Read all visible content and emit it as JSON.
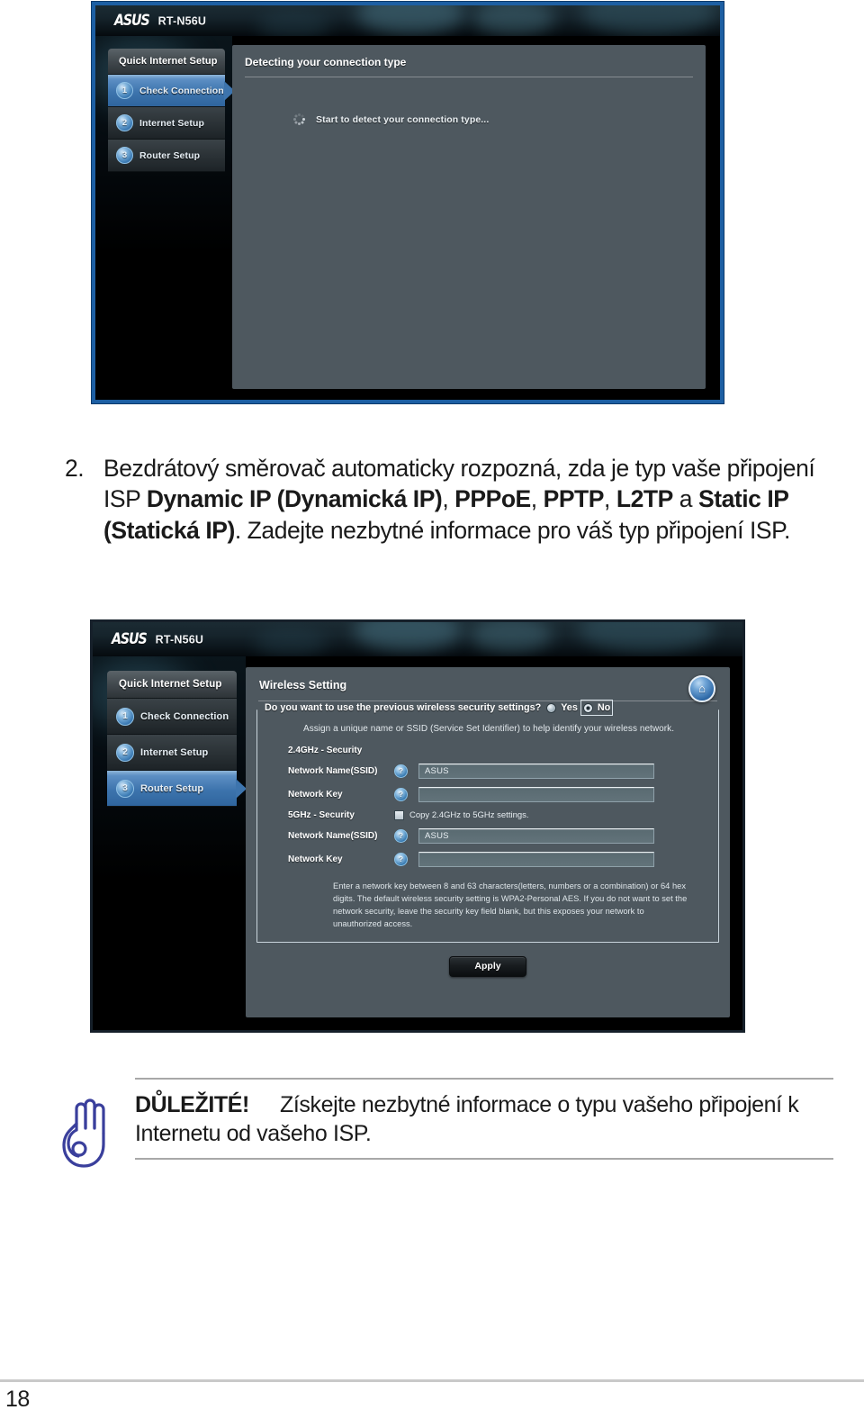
{
  "document": {
    "page_number": "18",
    "step": {
      "number": "2.",
      "text_part1": "Bezdrátový směrovač automaticky rozpozná, zda je typ vaše připojení ISP ",
      "bold1": "Dynamic IP (Dynamická IP)",
      "text_part2": ", ",
      "bold2": "PPPoE",
      "text_part3": ", ",
      "bold3": "PPTP",
      "text_part4": ", ",
      "bold4": "L2TP",
      "text_part5": " a ",
      "bold5": "Static IP (Statická IP)",
      "text_part6": ". Zadejte nezbytné informace pro váš typ připojení ISP."
    },
    "note": {
      "icon": "hand-stop-icon",
      "label": "DŮLEŽITÉ!",
      "text": "Získejte nezbytné informace o typu vašeho připojení k Internetu od vašeho ISP."
    }
  },
  "screenshot1": {
    "caption": "asus-router-detecting-connection",
    "header": {
      "logo": "ASUS",
      "model": "RT-N56U"
    },
    "sidebar": {
      "title": "Quick Internet Setup",
      "items": [
        {
          "num": "1",
          "label": "Check Connection",
          "active": true
        },
        {
          "num": "2",
          "label": "Internet Setup",
          "active": false
        },
        {
          "num": "3",
          "label": "Router Setup",
          "active": false
        }
      ]
    },
    "panel": {
      "title": "Detecting your connection type",
      "status_icon": "loading-spinner-icon",
      "status_text": "Start to detect your connection type..."
    }
  },
  "screenshot2": {
    "caption": "asus-router-wireless-setting",
    "header": {
      "logo": "ASUS",
      "model": "RT-N56U"
    },
    "home_icon": "home-icon",
    "sidebar": {
      "title": "Quick Internet Setup",
      "items": [
        {
          "num": "1",
          "label": "Check Connection",
          "active": false
        },
        {
          "num": "2",
          "label": "Internet Setup",
          "active": false
        },
        {
          "num": "3",
          "label": "Router Setup",
          "active": true
        }
      ]
    },
    "panel": {
      "title": "Wireless Setting",
      "question": "Do you want to use the previous wireless security settings?",
      "radio_yes": "Yes",
      "radio_no": "No",
      "selected_radio": "No",
      "assign_note": "Assign a unique name or SSID (Service Set Identifier) to help identify your wireless network.",
      "section_24": "2.4GHz - Security",
      "section_5": "5GHz - Security",
      "help_glyph": "?",
      "fields_24": [
        {
          "label": "Network Name(SSID)",
          "value": "ASUS",
          "help": "help-icon"
        },
        {
          "label": "Network Key",
          "value": "",
          "help": "help-icon"
        }
      ],
      "copy_checkbox": {
        "label": "Copy 2.4GHz to 5GHz settings.",
        "checked": false
      },
      "fields_5": [
        {
          "label": "Network Name(SSID)",
          "value": "ASUS",
          "help": "help-icon"
        },
        {
          "label": "Network Key",
          "value": "",
          "help": "help-icon"
        }
      ],
      "help_text": "Enter a network key between 8 and 63 characters(letters, numbers or a combination) or 64 hex digits. The default wireless security setting is WPA2-Personal AES. If you do not want to set the network security, leave the security key field blank, but this exposes your network to unauthorized access.",
      "apply_label": "Apply"
    }
  },
  "colors": {
    "shot1_border": "#1d5fa3",
    "shot2_border": "#16202a",
    "ui_content_bg": "#4e585f",
    "nav_active": "#3d74ad",
    "note_icon": "#3a3f9c",
    "rule": "#a8a8a8"
  }
}
